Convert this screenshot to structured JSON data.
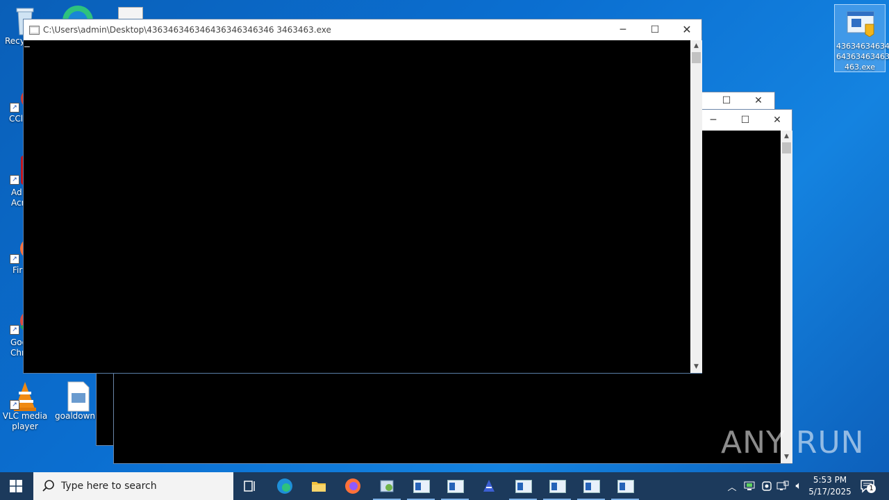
{
  "desktop": {
    "icons": [
      {
        "label": "Recy",
        "name": "recycle-bin"
      },
      {
        "label": "CCl",
        "name": "ccleaner"
      },
      {
        "label": "Ad\nAcr",
        "name": "adobe-acrobat"
      },
      {
        "label": "Fir",
        "name": "firefox"
      },
      {
        "label": "Goo\nChr",
        "name": "google-chrome"
      },
      {
        "label": "VLC media player",
        "name": "vlc-media-player"
      },
      {
        "label": "goaldownl",
        "name": "goaldownload"
      },
      {
        "label": "43634634634 64363463463 463.exe",
        "name": "exe-file"
      }
    ]
  },
  "windows": {
    "front": {
      "title": "C:\\Users\\admin\\Desktop\\436346346346436346346346 3463463.exe",
      "cursor": "_"
    }
  },
  "watermark": "ANY RUN",
  "taskbar": {
    "search_placeholder": "Type here to search",
    "clock_time": "5:53 PM",
    "clock_date": "5/17/2025",
    "notification_count": "1"
  }
}
